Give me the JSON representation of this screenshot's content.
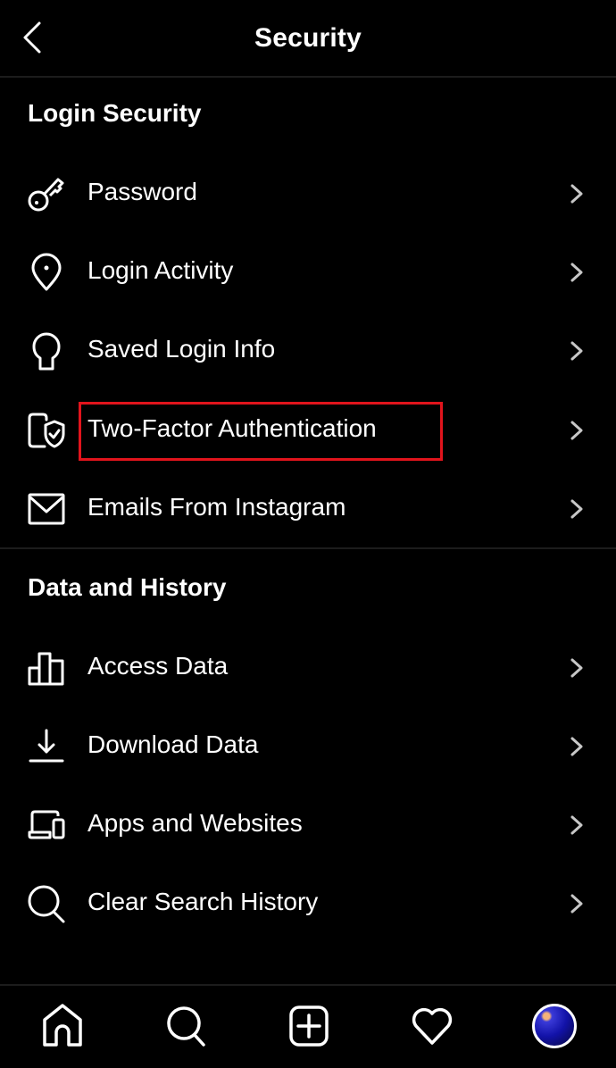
{
  "header": {
    "title": "Security",
    "back_icon": "chevron-left-icon"
  },
  "sections": [
    {
      "title": "Login Security",
      "items": [
        {
          "label": "Password",
          "icon": "key-icon"
        },
        {
          "label": "Login Activity",
          "icon": "location-pin-icon"
        },
        {
          "label": "Saved Login Info",
          "icon": "keyhole-icon"
        },
        {
          "label": "Two-Factor Authentication",
          "icon": "phone-shield-icon",
          "highlighted": true
        },
        {
          "label": "Emails From Instagram",
          "icon": "envelope-icon"
        }
      ]
    },
    {
      "title": "Data and History",
      "items": [
        {
          "label": "Access Data",
          "icon": "bar-chart-icon"
        },
        {
          "label": "Download Data",
          "icon": "download-icon"
        },
        {
          "label": "Apps and Websites",
          "icon": "devices-icon"
        },
        {
          "label": "Clear Search History",
          "icon": "search-icon"
        }
      ]
    }
  ],
  "tabbar": {
    "items": [
      "home-icon",
      "search-icon",
      "new-post-icon",
      "activity-heart-icon",
      "profile-avatar"
    ]
  },
  "colors": {
    "background": "#000000",
    "text": "#ffffff",
    "chevron": "#c7c7c7",
    "highlight_box": "#e1141c",
    "divider": "#1c1c1c"
  }
}
